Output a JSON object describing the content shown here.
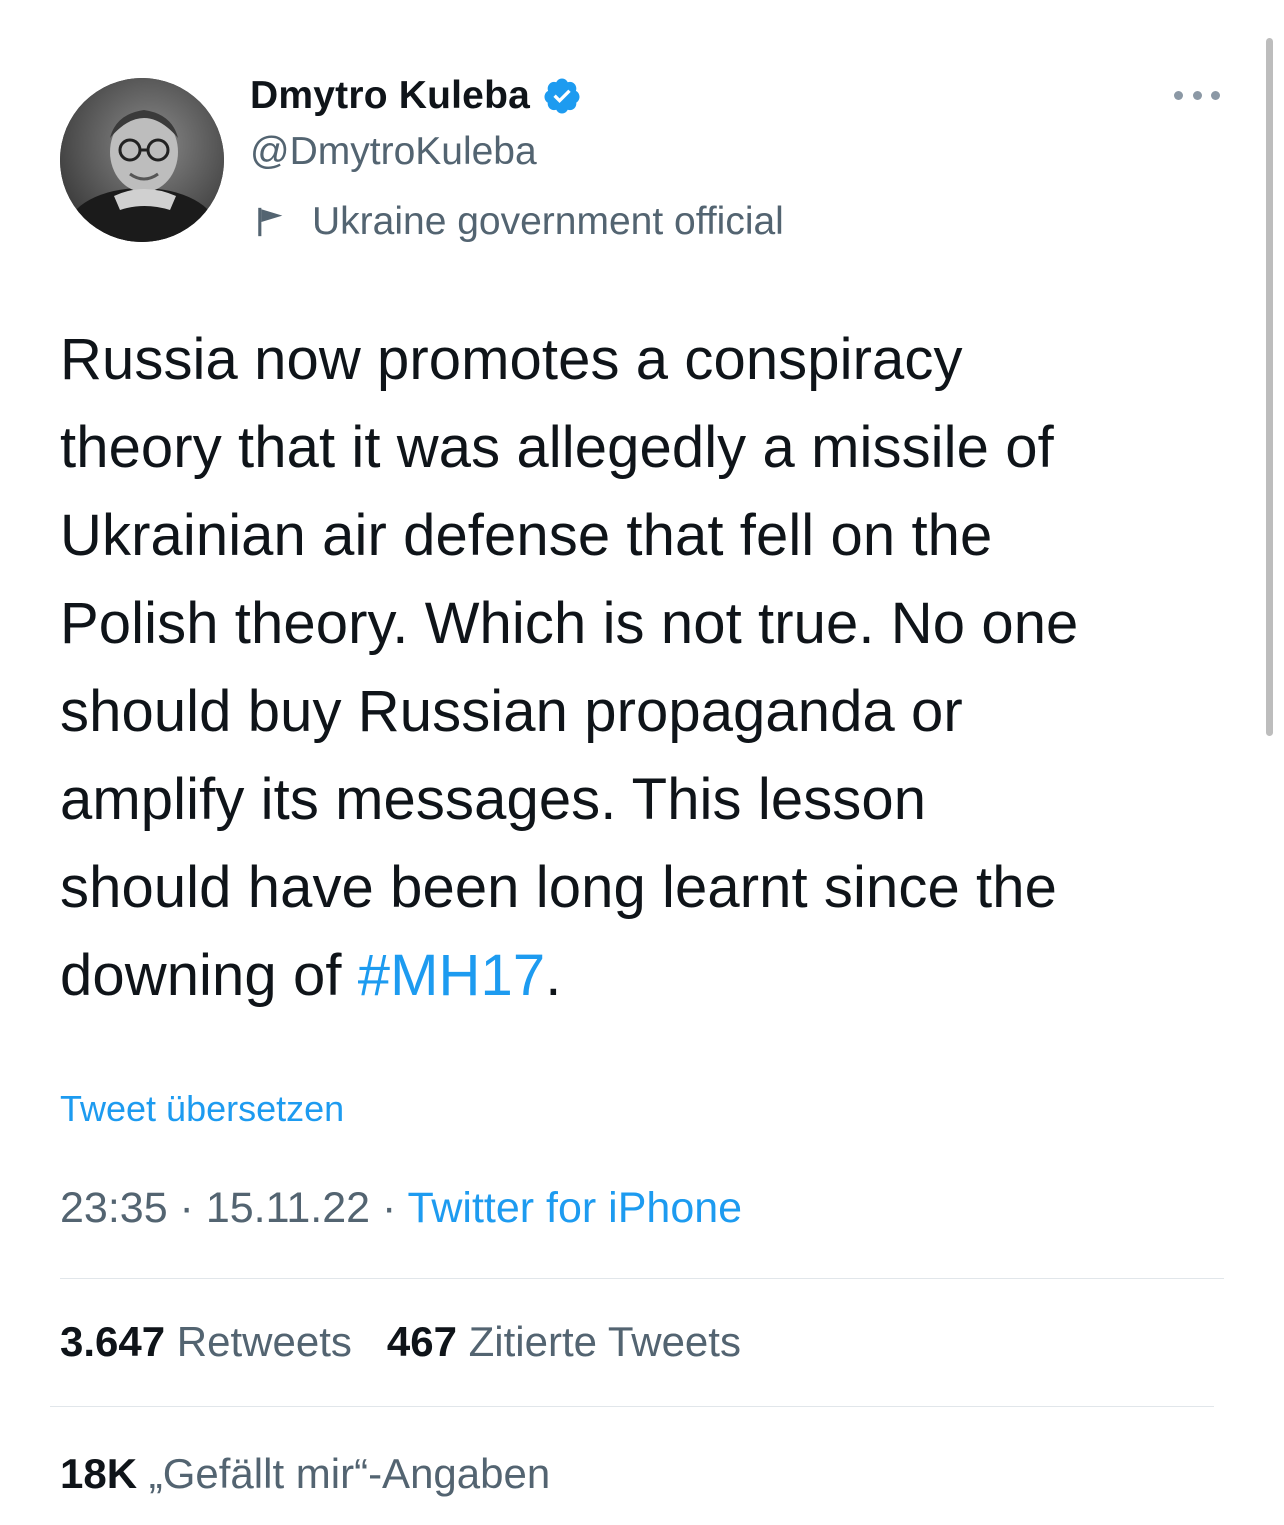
{
  "author": {
    "name": "Dmytro Kuleba",
    "handle": "@DmytroKuleba",
    "label": "Ukraine government official",
    "verified": true
  },
  "tweet": {
    "lines": [
      "Russia now promotes a conspiracy",
      "theory that it was allegedly a missile of",
      "Ukrainian air defense that fell on the",
      "Polish theory. Which is not true. No one",
      "should buy Russian propaganda or",
      "amplify its messages. This lesson",
      "should have been long learnt since the"
    ],
    "last_line_prefix": "downing of ",
    "hashtag": "#MH17",
    "last_line_suffix": "."
  },
  "translate_label": "Tweet übersetzen",
  "meta": {
    "time": "23:35",
    "separator": " · ",
    "date": "15.11.22",
    "source": "Twitter for iPhone"
  },
  "stats": {
    "retweets_count": "3.647",
    "retweets_label": "Retweets",
    "quotes_count": "467",
    "quotes_label": "Zitierte Tweets",
    "likes_count": "18K",
    "likes_label": "„Gefällt mir“-Angaben"
  },
  "colors": {
    "accent": "#1d9bf0",
    "text": "#0f1419",
    "secondary": "#536471"
  }
}
